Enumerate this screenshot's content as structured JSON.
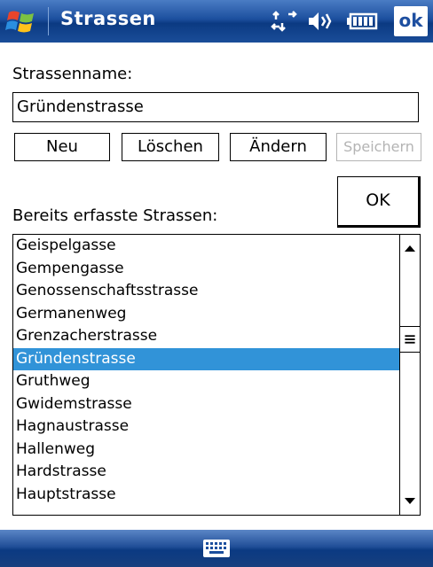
{
  "titlebar": {
    "title": "Strassen",
    "ok_label": "ok",
    "icons": [
      "windows-start-icon",
      "connectivity-icon",
      "volume-icon",
      "battery-icon"
    ]
  },
  "form": {
    "name_label": "Strassenname:",
    "name_value": "Gründenstrasse",
    "buttons": {
      "new": "Neu",
      "delete": "Löschen",
      "change": "Ändern",
      "save": "Speichern"
    },
    "ok_label": "OK",
    "list_label": "Bereits erfasste Strassen:"
  },
  "list": {
    "items": [
      "Geispelgasse",
      "Gempengasse",
      "Genossenschaftsstrasse",
      "Germanenweg",
      "Grenzacherstrasse",
      "Gründenstrasse",
      "Gruthweg",
      "Gwidemstrasse",
      "Hagnaustrasse",
      "Hallenweg",
      "Hardstrasse",
      "Hauptstrasse"
    ],
    "selected": "Gründenstrasse"
  },
  "bottombar": {
    "icon": "keyboard-icon"
  },
  "colors": {
    "title_bg": "#1c4f9e",
    "selection": "#3193d8",
    "disabled_text": "#b4b4b4"
  }
}
